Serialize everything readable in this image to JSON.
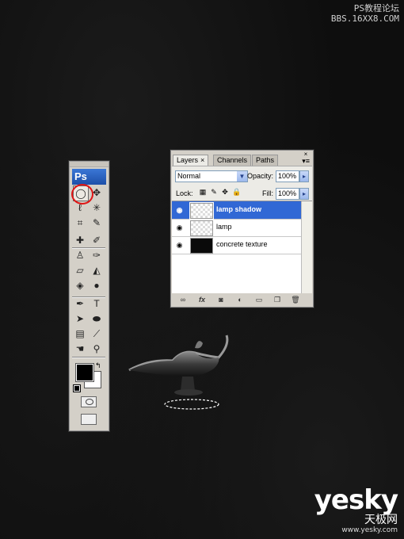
{
  "watermark": {
    "top_line1": "PS教程论坛",
    "top_line2": "BBS.16XX8.COM",
    "brand": "yesky",
    "brand_cn": "天极网",
    "brand_url": "www.yesky.com"
  },
  "toolbox": {
    "logo": "Ps",
    "tools": [
      {
        "name": "elliptical-marquee-tool",
        "icon": "ellipse-marquee-icon",
        "glyph": "◯",
        "selected": true
      },
      {
        "name": "move-tool",
        "icon": "move-icon",
        "glyph": "✥"
      },
      {
        "name": "lasso-tool",
        "icon": "lasso-icon",
        "glyph": "ℓ"
      },
      {
        "name": "magic-wand-tool",
        "icon": "magic-wand-icon",
        "glyph": "✳"
      },
      {
        "name": "crop-tool",
        "icon": "crop-icon",
        "glyph": "⌗"
      },
      {
        "name": "slice-tool",
        "icon": "slice-icon",
        "glyph": "✎"
      },
      {
        "name": "healing-brush-tool",
        "icon": "healing-brush-icon",
        "glyph": "✚"
      },
      {
        "name": "brush-tool",
        "icon": "brush-icon",
        "glyph": "✐"
      },
      {
        "name": "clone-stamp-tool",
        "icon": "stamp-icon",
        "glyph": "♙"
      },
      {
        "name": "history-brush-tool",
        "icon": "history-brush-icon",
        "glyph": "✑"
      },
      {
        "name": "eraser-tool",
        "icon": "eraser-icon",
        "glyph": "▱"
      },
      {
        "name": "paint-bucket-tool",
        "icon": "paint-bucket-icon",
        "glyph": "◭"
      },
      {
        "name": "blur-tool",
        "icon": "blur-icon",
        "glyph": "◈"
      },
      {
        "name": "dodge-tool",
        "icon": "dodge-icon",
        "glyph": "●"
      },
      {
        "name": "pen-tool",
        "icon": "pen-icon",
        "glyph": "✒"
      },
      {
        "name": "type-tool",
        "icon": "type-icon",
        "glyph": "T"
      },
      {
        "name": "path-selection-tool",
        "icon": "path-select-icon",
        "glyph": "➤"
      },
      {
        "name": "shape-tool",
        "icon": "ellipse-shape-icon",
        "glyph": "⬬"
      },
      {
        "name": "notes-tool",
        "icon": "notes-icon",
        "glyph": "▤"
      },
      {
        "name": "eyedropper-tool",
        "icon": "eyedropper-icon",
        "glyph": "⟋"
      },
      {
        "name": "hand-tool",
        "icon": "hand-icon",
        "glyph": "☚"
      },
      {
        "name": "zoom-tool",
        "icon": "zoom-icon",
        "glyph": "⚲"
      }
    ],
    "swap_glyph": "↰",
    "colors": {
      "foreground": "#000000",
      "background": "#ffffff"
    }
  },
  "layers_panel": {
    "tabs": [
      {
        "label": "Layers",
        "active": true,
        "close": "×"
      },
      {
        "label": "Channels",
        "active": false
      },
      {
        "label": "Paths",
        "active": false
      }
    ],
    "top_close": "×",
    "menu_glyph": "▾≡",
    "blend_mode": "Normal",
    "opacity_label": "Opacity:",
    "opacity_value": "100%",
    "lock_label": "Lock:",
    "lock_icons": [
      "lock-transparent-icon",
      "lock-image-icon",
      "lock-position-icon",
      "lock-all-icon"
    ],
    "fill_label": "Fill:",
    "fill_value": "100%",
    "layers": [
      {
        "name": "lamp shadow",
        "selected": true,
        "thumb": "transparent",
        "eye": "◉"
      },
      {
        "name": "lamp",
        "selected": false,
        "thumb": "transparent",
        "eye": "◉"
      },
      {
        "name": "concrete texture",
        "selected": false,
        "thumb": "dark",
        "eye": "◉"
      }
    ],
    "footer_buttons": [
      {
        "name": "link-layers-button",
        "icon": "link-icon",
        "glyph": "∞"
      },
      {
        "name": "layer-style-button",
        "icon": "fx-icon",
        "glyph": "fx"
      },
      {
        "name": "layer-mask-button",
        "icon": "mask-icon",
        "glyph": "◙"
      },
      {
        "name": "adjustment-layer-button",
        "icon": "adjustment-icon",
        "glyph": "◐"
      },
      {
        "name": "new-group-button",
        "icon": "folder-icon",
        "glyph": "▭"
      },
      {
        "name": "new-layer-button",
        "icon": "new-layer-icon",
        "glyph": "❐"
      },
      {
        "name": "delete-layer-button",
        "icon": "trash-icon",
        "glyph": "🗑"
      }
    ]
  },
  "colors": {
    "selection": "#3168d5",
    "accent_blue": "#1d4fa8",
    "highlight_circle": "#e01515"
  }
}
